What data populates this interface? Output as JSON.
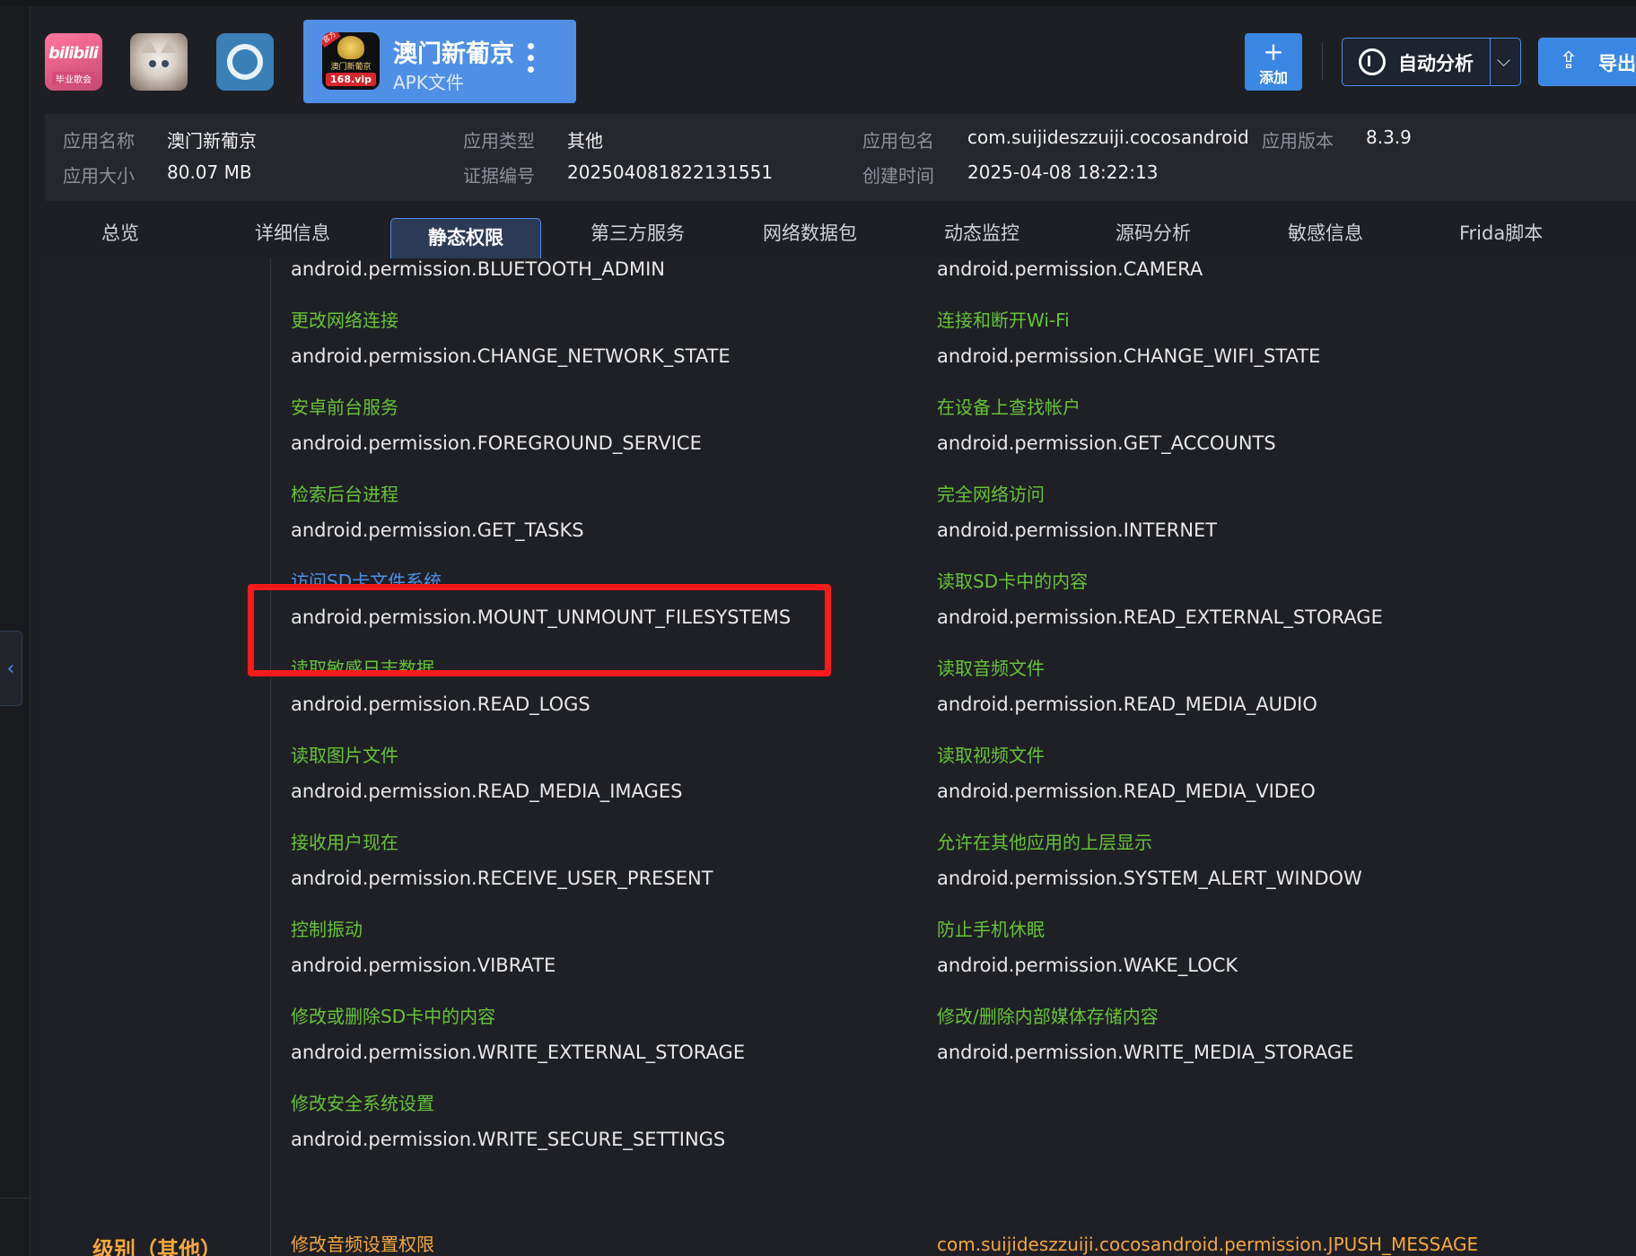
{
  "app_tabs": {
    "shortcut_labels": [
      "bilibili",
      "毕业歌会"
    ],
    "current": {
      "title": "澳门新葡京",
      "subtitle": "APK文件",
      "logo_text": "澳门新葡京",
      "logo_vip": "168.vip",
      "logo_badge": "官方"
    }
  },
  "toolbar": {
    "add_label": "添加",
    "add_icon": "+",
    "auto_label": "自动分析",
    "export_label": "导出",
    "dropdown_icon": "⌵",
    "upload_icon": "⇪"
  },
  "info": {
    "name_key": "应用名称",
    "name_val": "澳门新葡京",
    "type_key": "应用类型",
    "type_val": "其他",
    "pkg_key": "应用包名",
    "pkg_val": "com.suijideszzuiji.cocosandroid",
    "ver_key": "应用版本",
    "ver_val": "8.3.9",
    "size_key": "应用大小",
    "size_val": "80.07 MB",
    "cert_key": "证据编号",
    "cert_val": "202504081822131551",
    "time_key": "创建时间",
    "time_val": "2025-04-08 18:22:13"
  },
  "tabs": [
    "总览",
    "详细信息",
    "静态权限",
    "第三方服务",
    "网络数据包",
    "动态监控",
    "源码分析",
    "敏感信息",
    "Frida脚本"
  ],
  "active_tab": "静态权限",
  "level_label": "级别（其他）",
  "permissions_left": [
    {
      "cn": "",
      "en": "android.permission.BLUETOOTH_ADMIN"
    },
    {
      "cn": "更改网络连接",
      "en": "android.permission.CHANGE_NETWORK_STATE"
    },
    {
      "cn": "安卓前台服务",
      "en": "android.permission.FOREGROUND_SERVICE"
    },
    {
      "cn": "检索后台进程",
      "en": "android.permission.GET_TASKS"
    },
    {
      "cn": "访问SD卡文件系统",
      "en": "android.permission.MOUNT_UNMOUNT_FILESYSTEMS"
    },
    {
      "cn": "读取敏感日志数据",
      "en": "android.permission.READ_LOGS"
    },
    {
      "cn": "读取图片文件",
      "en": "android.permission.READ_MEDIA_IMAGES"
    },
    {
      "cn": "接收用户现在",
      "en": "android.permission.RECEIVE_USER_PRESENT"
    },
    {
      "cn": "控制振动",
      "en": "android.permission.VIBRATE"
    },
    {
      "cn": "修改或删除SD卡中的内容",
      "en": "android.permission.WRITE_EXTERNAL_STORAGE"
    },
    {
      "cn": "修改安全系统设置",
      "en": "android.permission.WRITE_SECURE_SETTINGS"
    },
    {
      "cn": "修改音频设置权限",
      "en": ""
    }
  ],
  "permissions_right": [
    {
      "cn": "",
      "en": "android.permission.CAMERA"
    },
    {
      "cn": "连接和断开Wi-Fi",
      "en": "android.permission.CHANGE_WIFI_STATE"
    },
    {
      "cn": "在设备上查找帐户",
      "en": "android.permission.GET_ACCOUNTS"
    },
    {
      "cn": "完全网络访问",
      "en": "android.permission.INTERNET"
    },
    {
      "cn": "读取SD卡中的内容",
      "en": "android.permission.READ_EXTERNAL_STORAGE"
    },
    {
      "cn": "读取音频文件",
      "en": "android.permission.READ_MEDIA_AUDIO"
    },
    {
      "cn": "读取视频文件",
      "en": "android.permission.READ_MEDIA_VIDEO"
    },
    {
      "cn": "允许在其他应用的上层显示",
      "en": "android.permission.SYSTEM_ALERT_WINDOW"
    },
    {
      "cn": "防止手机休眠",
      "en": "android.permission.WAKE_LOCK"
    },
    {
      "cn": "修改/删除内部媒体存储内容",
      "en": "android.permission.WRITE_MEDIA_STORAGE"
    },
    {
      "cn": "com.suijideszzuiji.cocosandroid.permission.JPUSH_MESSAGE",
      "en": ""
    }
  ],
  "colors": {
    "accent": "#4f8fe6",
    "permission_cn": "#67c23a",
    "level": "#f3a73f",
    "highlight_box": "#ff1a1a"
  }
}
